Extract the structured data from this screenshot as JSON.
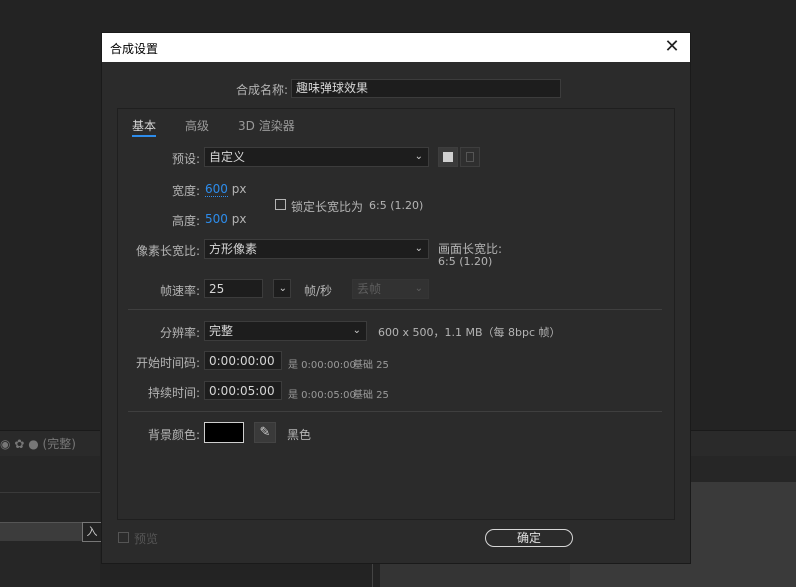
{
  "background": {
    "toolbar_status": "(完整)",
    "field_letter": "入"
  },
  "dialog": {
    "title": "合成设置",
    "name_label": "合成名称:",
    "name_value": "趣味弹球效果",
    "tabs": [
      {
        "label": "基本",
        "active": true
      },
      {
        "label": "高级",
        "active": false
      },
      {
        "label": "3D 渲染器",
        "active": false
      }
    ],
    "preset_label": "预设:",
    "preset_value": "自定义",
    "width_label": "宽度:",
    "width_value": "600",
    "width_unit": "px",
    "height_label": "高度:",
    "height_value": "500",
    "height_unit": "px",
    "lock_label": "锁定长宽比为",
    "lock_ratio": "6:5 (1.20)",
    "pixel_aspect_label": "像素长宽比:",
    "pixel_aspect_value": "方形像素",
    "frame_aspect_label": "画面长宽比:",
    "frame_aspect_value": "6:5 (1.20)",
    "fps_label": "帧速率:",
    "fps_value": "25",
    "fps_unit": "帧/秒",
    "drop_frame": "丢帧",
    "resolution_label": "分辨率:",
    "resolution_value": "完整",
    "resolution_info": "600 x 500，1.1 MB（每 8bpc 帧）",
    "start_tc_label": "开始时间码:",
    "start_tc_value": "0:00:00:00",
    "start_tc_info_eq": "是 0:00:00:00",
    "start_tc_info_base": "基础 25",
    "duration_label": "持续时间:",
    "duration_value": "0:00:05:00",
    "duration_info_eq": "是 0:00:05:00",
    "duration_info_base": "基础 25",
    "bg_color_label": "背景颜色:",
    "bg_color_name": "黑色",
    "bg_color_hex": "#000000",
    "preview_label": "预览",
    "ok_label": "确定"
  },
  "colors": {
    "accent": "#2d8ceb",
    "dialog_bg": "#2b2b2b",
    "titlebar": "#ffffff"
  }
}
